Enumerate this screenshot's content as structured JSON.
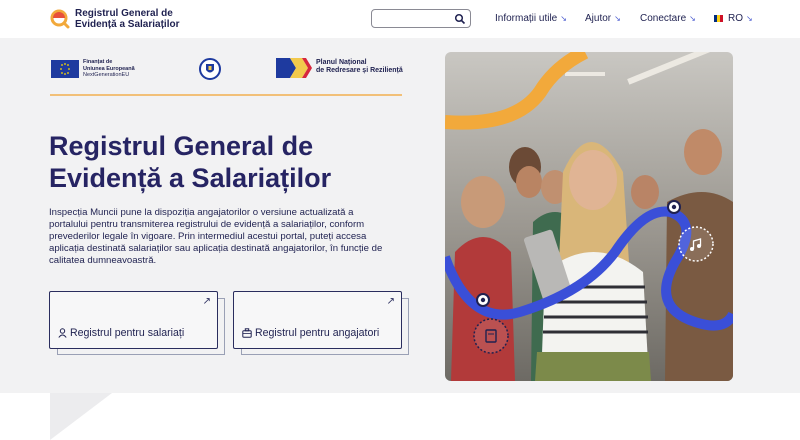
{
  "header": {
    "brand_line1": "Registrul General de",
    "brand_line2": "Evidență a Salariaților",
    "search_placeholder": "",
    "nav": [
      {
        "label": "Informații utile"
      },
      {
        "label": "Ajutor"
      },
      {
        "label": "Conectare"
      },
      {
        "label": "RO"
      }
    ]
  },
  "funding": {
    "eu_line1": "Finanțat de",
    "eu_line2": "Uniunea Europeană",
    "eu_line3": "NextGenerationEU",
    "pnrr_line1": "Planul Național",
    "pnrr_line2": "de Redresare și Reziliență"
  },
  "hero": {
    "title_line1": "Registrul General de",
    "title_line2": "Evidență a Salariaților",
    "text": "Inspecția Muncii pune la dispoziția angajatorilor o versiune actualizată a portalului pentru transmiterea registrului de evidență a salariaților, conform prevederilor legale în vigoare. Prin intermediul acestui portal, puteți accesa aplicația destinată salariaților sau aplicația destinată angajatorilor, în funcție de calitatea dumneavoastră.",
    "card_employees": "Registrul pentru salariați",
    "card_employers": "Registrul pentru angajatori"
  },
  "colors": {
    "brand": "#262463",
    "accent_orange": "#f2a93b",
    "accent_blue": "#3a4fd8"
  },
  "icons": [
    "search-icon",
    "arrow-icon",
    "flag-icon",
    "user-icon",
    "briefcase-icon",
    "music-icon",
    "book-icon"
  ]
}
